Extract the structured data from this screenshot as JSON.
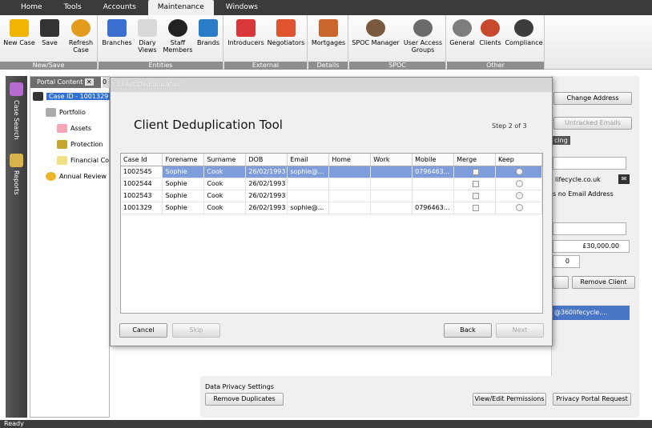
{
  "ribbon": {
    "tabs": [
      "Home",
      "Tools",
      "Accounts",
      "Maintenance",
      "Windows"
    ],
    "groups": [
      {
        "label": "New/Save",
        "buttons": [
          "New Case",
          "Save",
          "Refresh Case"
        ]
      },
      {
        "label": "Entities",
        "buttons": [
          "Branches",
          "Diary Views",
          "Staff Members",
          "Brands"
        ]
      },
      {
        "label": "External",
        "buttons": [
          "Introducers",
          "Negotiators"
        ]
      },
      {
        "label": "Details",
        "buttons": [
          "Mortgages"
        ]
      },
      {
        "label": "SPOC",
        "buttons": [
          "SPOC Manager",
          "User Access Groups"
        ]
      },
      {
        "label": "Other",
        "buttons": [
          "General",
          "Clients",
          "Compliance"
        ]
      }
    ]
  },
  "rail": {
    "case_search": "Case Search",
    "reports": "Reports"
  },
  "portal": {
    "tab_label": "Portal Content",
    "tab2_label": "0",
    "tree": [
      "Case ID - 1001329",
      "Portfolio",
      "Assets",
      "Protection",
      "Financial Co",
      "Annual Review"
    ]
  },
  "background": {
    "change_address": "Change Address",
    "untracked_emails": "Untracked Emails",
    "tab_fragment": "cing",
    "email_fragment": "lifecycle.co.uk",
    "no_email": "s no Email Address",
    "amount": "£30,000.00",
    "count": "0",
    "remove_client": "Remove Client",
    "email_row": "@360lifecycle....",
    "data_privacy": "Data Privacy Settings",
    "remove_duplicates": "Remove Duplicates",
    "view_edit": "View/Edit Permissions",
    "privacy_request": "Privacy Portal Request"
  },
  "dialog": {
    "window_title": "Client Deduplication",
    "heading": "Client Deduplication Tool",
    "step": "Step 2 of 3",
    "columns": [
      "Case Id",
      "Forename",
      "Surname",
      "DOB",
      "Email",
      "Home",
      "Work",
      "Mobile",
      "Merge",
      "Keep"
    ],
    "rows": [
      [
        "1002545",
        "Sophie",
        "Cook",
        "26/02/1993",
        "sophie@...",
        "",
        "",
        "0796463...",
        "",
        ""
      ],
      [
        "1002544",
        "Sophie",
        "Cook",
        "26/02/1993",
        "",
        "",
        "",
        "",
        "",
        ""
      ],
      [
        "1002543",
        "Sophie",
        "Cook",
        "26/02/1993",
        "",
        "",
        "",
        "",
        "",
        ""
      ],
      [
        "1001329",
        "Sophie",
        "Cook",
        "26/02/1993",
        "sophie@...",
        "",
        "",
        "0796463...",
        "",
        ""
      ]
    ],
    "buttons": {
      "cancel": "Cancel",
      "skip": "Skip",
      "back": "Back",
      "next": "Next"
    }
  },
  "status": "Ready"
}
